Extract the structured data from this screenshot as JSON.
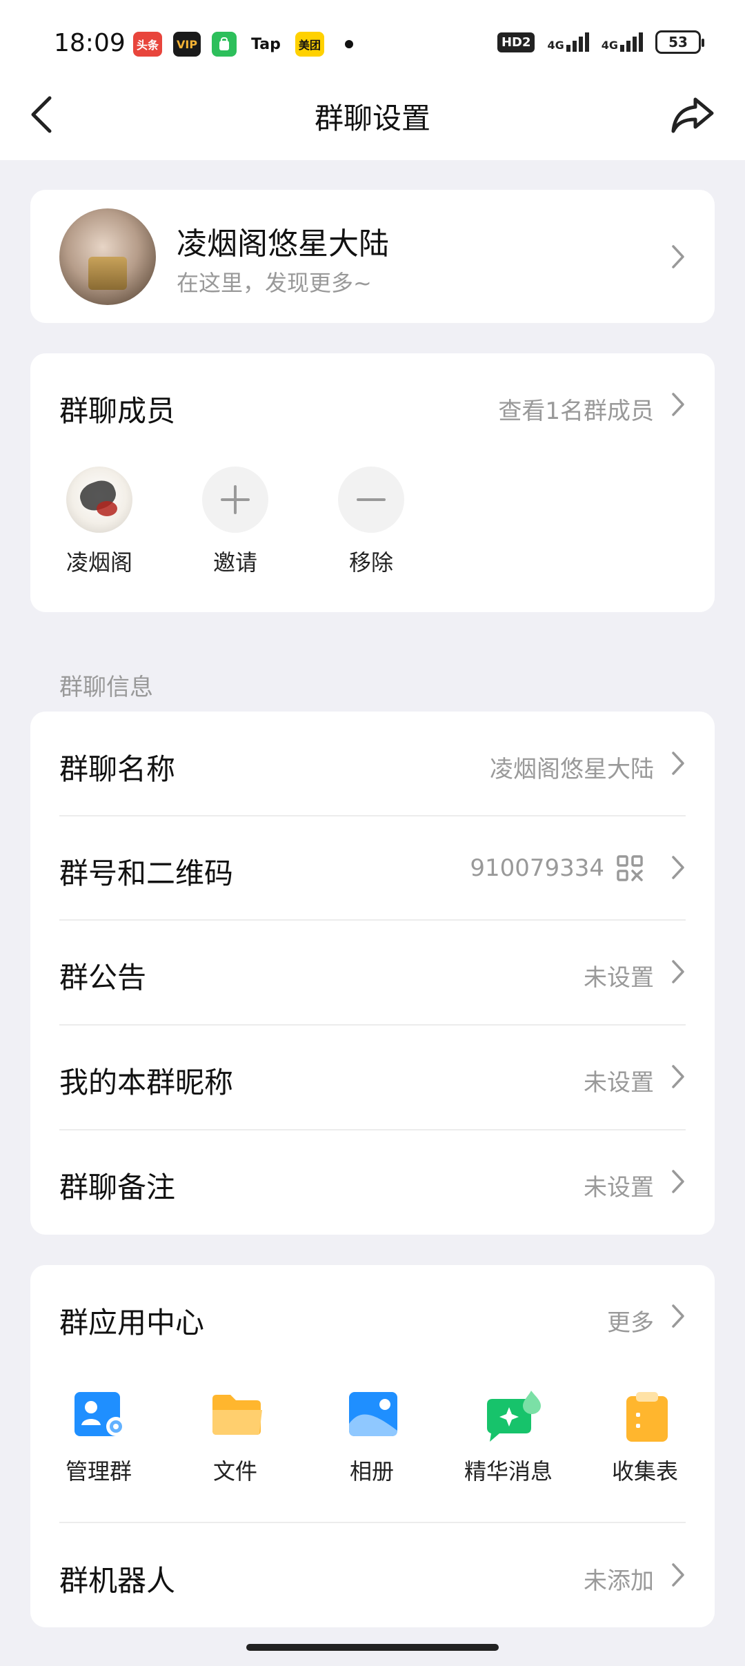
{
  "status_bar": {
    "time": "18:09",
    "apps": [
      {
        "label": "头条",
        "bg": "#e8453c",
        "fg": "#ffffff"
      },
      {
        "label": "VIP",
        "bg": "#1a1a1a",
        "fg": "#f5b335"
      },
      {
        "label": "",
        "bg": "#2dbf5b",
        "fg": "#ffffff"
      },
      {
        "label": "Tap",
        "bg": "#ffffff",
        "fg": "#111111"
      },
      {
        "label": "美团",
        "bg": "#ffd100",
        "fg": "#111111"
      }
    ],
    "hd_label": "HD2",
    "signal_1": "4G",
    "signal_2": "4G",
    "battery": "53"
  },
  "nav": {
    "title": "群聊设置",
    "back_icon": "chevron-left-icon",
    "share_icon": "share-icon"
  },
  "group": {
    "name": "凌烟阁悠星大陆",
    "subtitle": "在这里，发现更多~"
  },
  "members": {
    "title": "群聊成员",
    "view_all": "查看1名群成员",
    "items": [
      {
        "label": "凌烟阁"
      },
      {
        "label": "邀请"
      },
      {
        "label": "移除"
      }
    ]
  },
  "info": {
    "section_label": "群聊信息",
    "rows": [
      {
        "title": "群聊名称",
        "value": "凌烟阁悠星大陆"
      },
      {
        "title": "群号和二维码",
        "value": "910079334"
      },
      {
        "title": "群公告",
        "value": "未设置"
      },
      {
        "title": "我的本群昵称",
        "value": "未设置"
      },
      {
        "title": "群聊备注",
        "value": "未设置"
      }
    ]
  },
  "apps": {
    "title": "群应用中心",
    "more": "更多",
    "items": [
      {
        "label": "管理群",
        "icon": "manage-group-icon",
        "color": "#1f8fff"
      },
      {
        "label": "文件",
        "icon": "folder-icon",
        "color": "#ffb62e"
      },
      {
        "label": "相册",
        "icon": "album-icon",
        "color": "#1f8fff"
      },
      {
        "label": "精华消息",
        "icon": "essence-message-icon",
        "color": "#17c36b"
      },
      {
        "label": "收集表",
        "icon": "clipboard-icon",
        "color": "#ffb62e"
      }
    ],
    "robot": {
      "title": "群机器人",
      "value": "未添加"
    }
  }
}
